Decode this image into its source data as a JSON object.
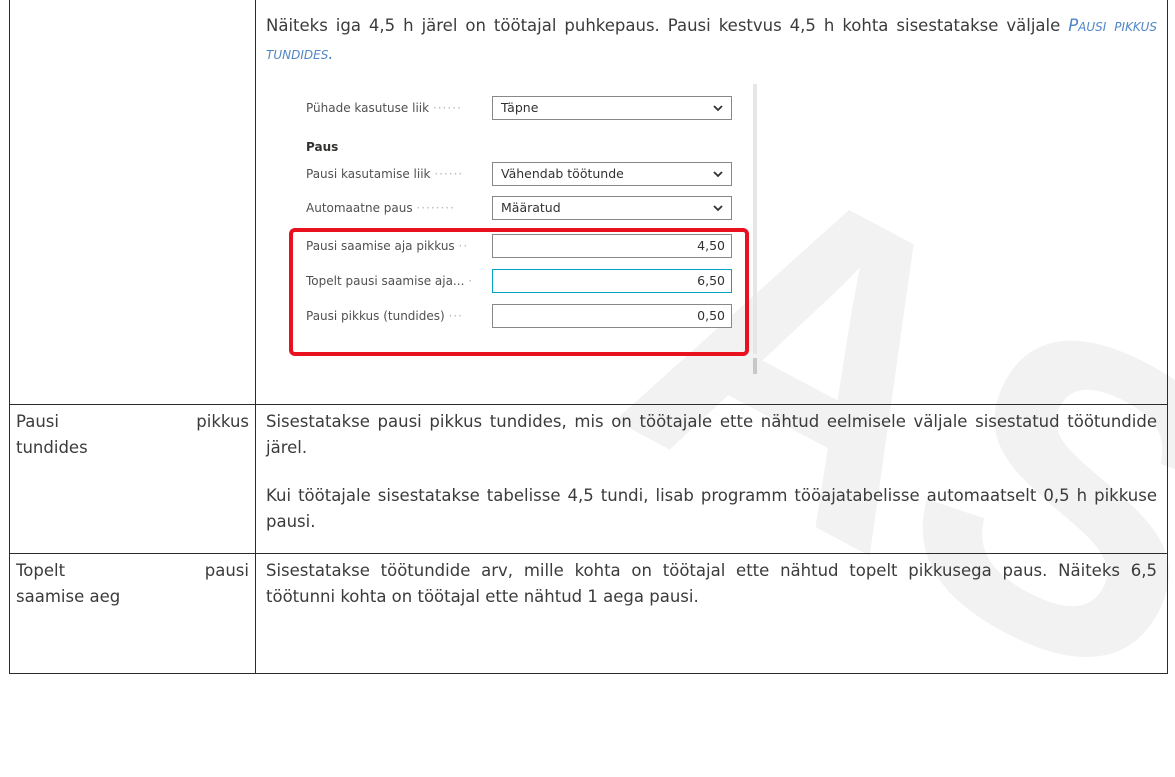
{
  "watermark": "AS",
  "rows": [
    {
      "label": "",
      "intro": {
        "text_before": "Näiteks iga 4,5 h järel on töötajal puhkepaus. Pausi kestvus 4,5 h kohta sisestatakse väljale ",
        "field_ref": "Pausi pikkus tundides."
      },
      "form": {
        "holiday_usage_label": "Pühade kasutuse liik",
        "holiday_usage_value": "Täpne",
        "section_title": "Paus",
        "break_usage_label": "Pausi kasutamise liik",
        "break_usage_value": "Vähendab töötunde",
        "auto_break_label": "Automaatne paus",
        "auto_break_value": "Määratud",
        "break_time_label": "Pausi saamise aja pikkus",
        "break_time_value": "4,50",
        "double_break_label": "Topelt pausi saamise aja...",
        "double_break_value": "6,50",
        "break_length_label": "Pausi pikkus (tundides)",
        "break_length_value": "0,50"
      }
    },
    {
      "label_line1_a": "Pausi",
      "label_line1_b": "pikkus",
      "label_line2": "tundides",
      "para1": "Sisestatakse pausi pikkus tundides, mis on töötajale ette nähtud eelmisele väljale sisestatud töötundide järel.",
      "para2": "Kui töötajale sisestatakse tabelisse 4,5 tundi, lisab programm tööajatabelisse automaatselt 0,5 h pikkuse pausi."
    },
    {
      "label_line1_a": "Topelt",
      "label_line1_b": "pausi",
      "label_line2": "saamise aeg",
      "para1": "Sisestatakse töötundide arv, mille kohta on töötajal ette nähtud topelt pikkusega paus. Näiteks 6,5 töötunni kohta on töötajal ette nähtud 1 aega pausi."
    }
  ]
}
